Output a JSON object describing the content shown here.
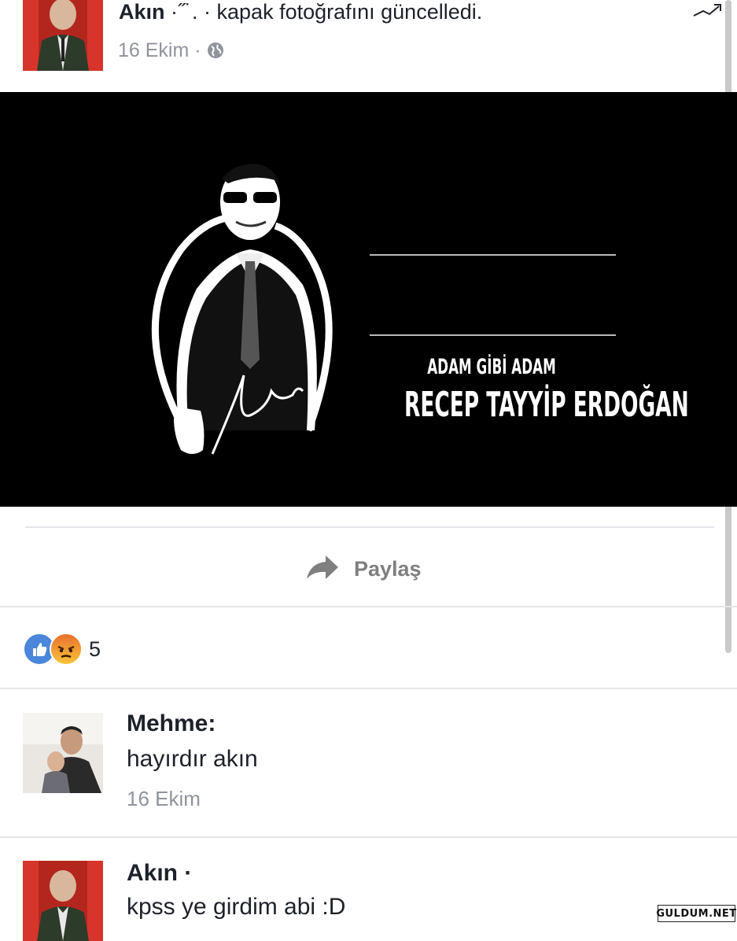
{
  "post": {
    "author": "Akın",
    "author_censored": "·˝˙. ·",
    "action": "kapak fotoğrafını güncelledi.",
    "time": "16 Ekim",
    "separator": "·",
    "privacy_icon": "globe-icon"
  },
  "cover": {
    "line1": "ADAM GİBİ ADAM",
    "line2": "RECEP TAYYİP ERDOĞAN"
  },
  "actions": {
    "share_label": "Paylaş",
    "share_icon": "share-arrow-icon"
  },
  "reactions": {
    "types": [
      "like-icon",
      "angry-icon"
    ],
    "count": "5"
  },
  "comments": [
    {
      "name": "Mehme:",
      "text": "hayırdır akın",
      "time": "16 Ekim"
    },
    {
      "name": "Akın ·",
      "text": "kpss ye girdim abi :D"
    }
  ],
  "watermark": "GULDUM.NET",
  "colors": {
    "like_blue": "#4a86d9",
    "meta_gray": "#90949c",
    "share_gray": "#7f7f7f"
  }
}
